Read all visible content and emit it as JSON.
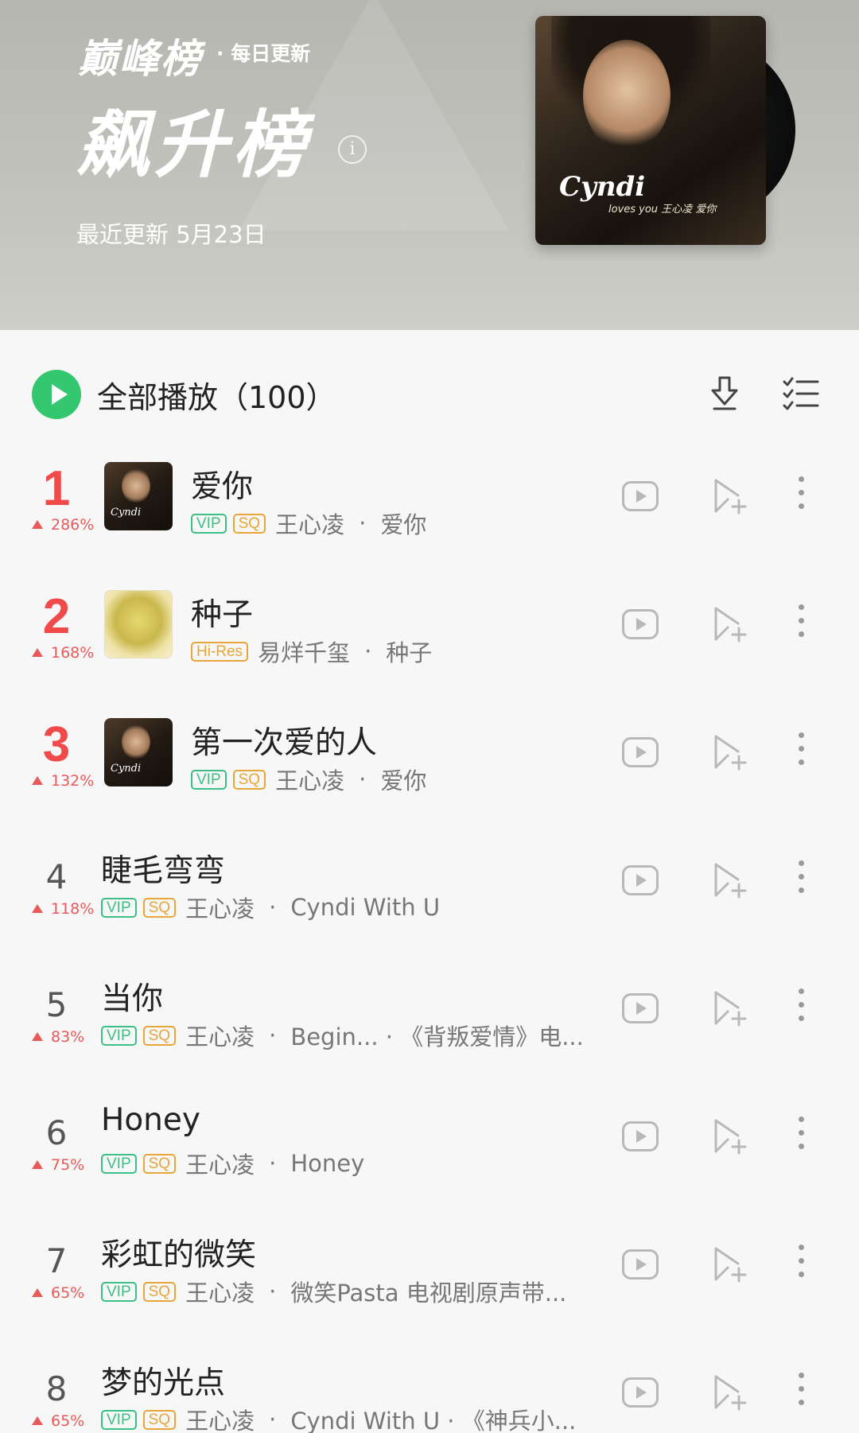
{
  "header": {
    "brand": "巅峰榜",
    "brand_sub": "· 每日更新",
    "title": "飙升榜",
    "info_glyph": "i",
    "update_text": "最近更新 5月23日",
    "cover": {
      "logo": "Cyndi",
      "sub": "loves you 王心凌 爱你"
    }
  },
  "toolbar": {
    "play_all_label": "全部播放（100）",
    "icons": [
      "download-icon",
      "multi-select-icon"
    ]
  },
  "songs": [
    {
      "rank": "1",
      "trend": "286%",
      "title": "爱你",
      "tags": [
        "VIP",
        "SQ"
      ],
      "artist": "王心凌",
      "dot": "·",
      "album": "爱你",
      "thumb": "cyndi"
    },
    {
      "rank": "2",
      "trend": "168%",
      "title": "种子",
      "tags": [
        "Hi-Res"
      ],
      "artist": "易烊千玺",
      "dot": "·",
      "album": "种子",
      "thumb": "seed"
    },
    {
      "rank": "3",
      "trend": "132%",
      "title": "第一次爱的人",
      "tags": [
        "VIP",
        "SQ"
      ],
      "artist": "王心凌",
      "dot": "·",
      "album": "爱你",
      "thumb": "cyndi"
    },
    {
      "rank": "4",
      "trend": "118%",
      "title": "睫毛弯弯",
      "tags": [
        "VIP",
        "SQ"
      ],
      "artist": "王心凌",
      "dot": "·",
      "album": "Cyndi With U"
    },
    {
      "rank": "5",
      "trend": "83%",
      "title": "当你",
      "tags": [
        "VIP",
        "SQ"
      ],
      "artist": "王心凌",
      "dot": "·",
      "album": "Begin... · 《背叛爱情》电..."
    },
    {
      "rank": "6",
      "trend": "75%",
      "title": "Honey",
      "tags": [
        "VIP",
        "SQ"
      ],
      "artist": "王心凌",
      "dot": "·",
      "album": "Honey"
    },
    {
      "rank": "7",
      "trend": "65%",
      "title": "彩虹的微笑",
      "tags": [
        "VIP",
        "SQ"
      ],
      "artist": "王心凌",
      "dot": "·",
      "album": "微笑Pasta 电视剧原声带..."
    },
    {
      "rank": "8",
      "trend": "65%",
      "title": "梦的光点",
      "tags": [
        "VIP",
        "SQ"
      ],
      "artist": "王心凌",
      "dot": "·",
      "album": "Cyndi With U · 《神兵小..."
    }
  ],
  "colors": {
    "accent_green": "#33c76f",
    "rank_red": "#f04a4a",
    "vip_green": "#3cbf86",
    "sq_orange": "#e8a63a"
  }
}
